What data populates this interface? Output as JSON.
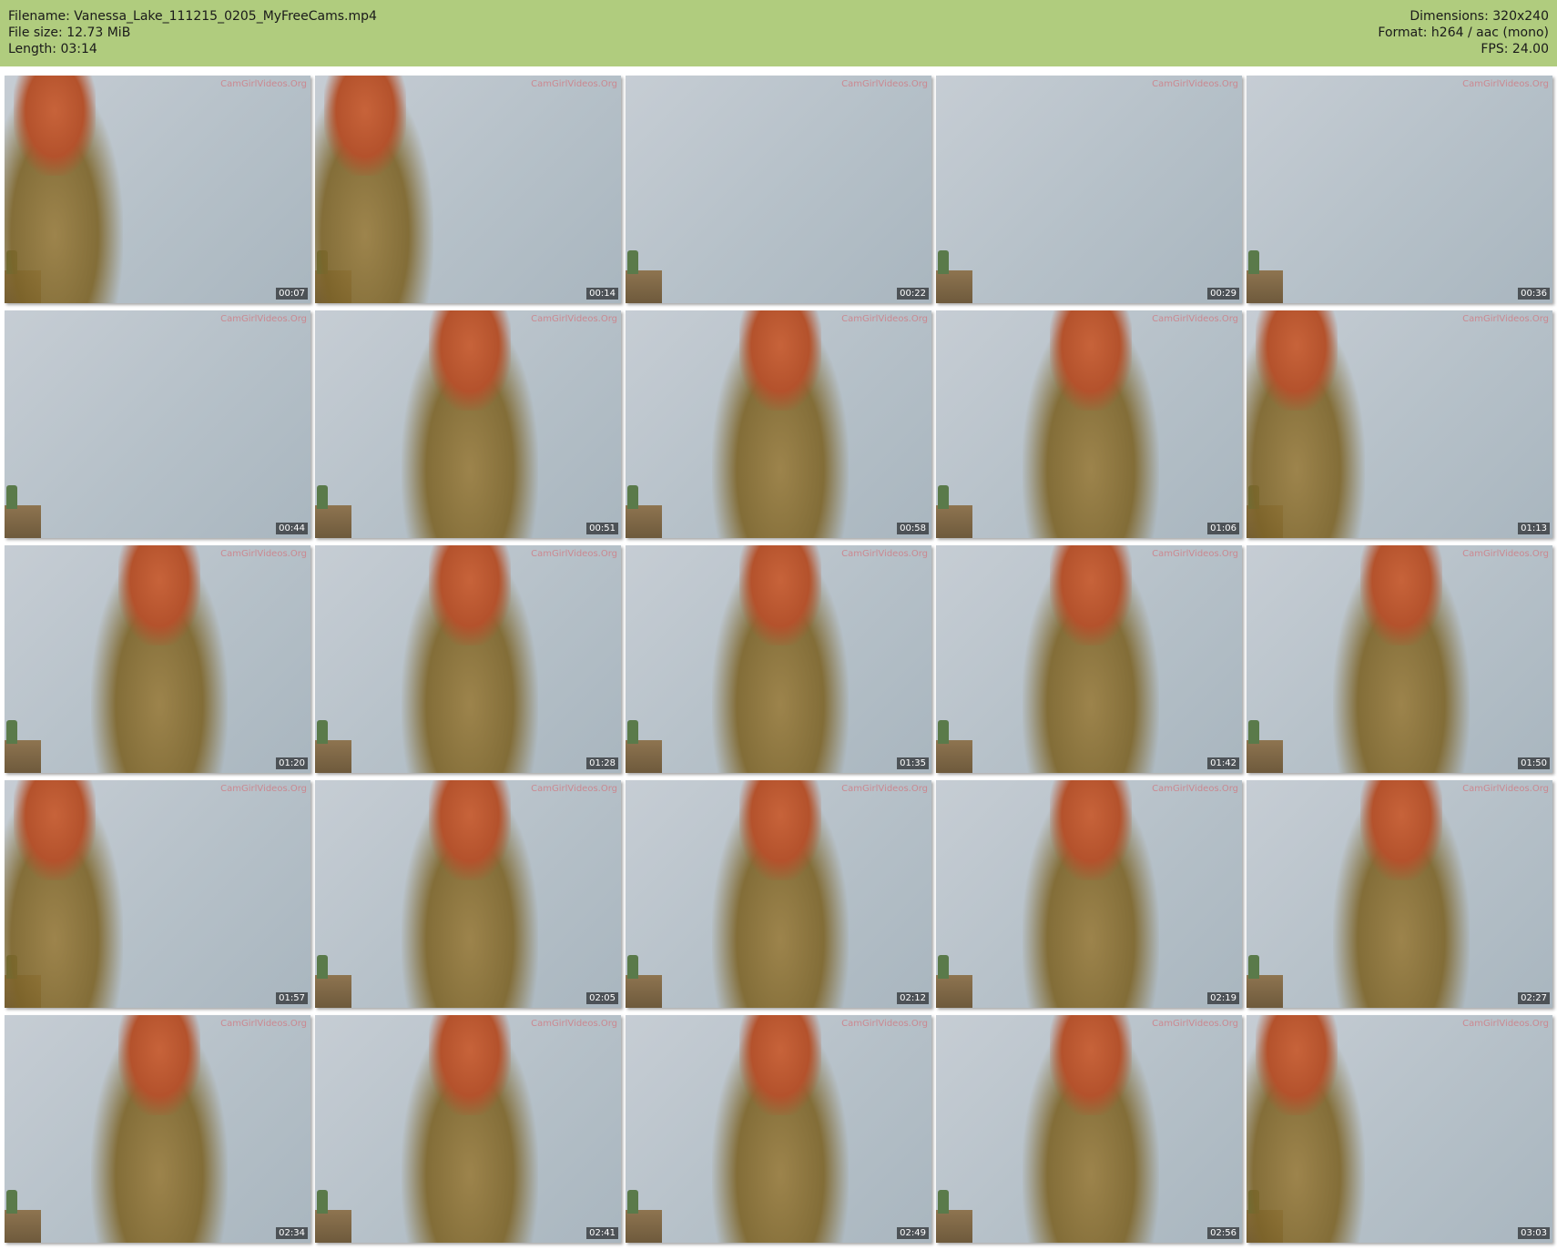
{
  "header": {
    "filename": "Filename: Vanessa_Lake_111215_0205_MyFreeCams.mp4",
    "filesize": "File size: 12.73 MiB",
    "length": "Length: 03:14",
    "dimensions": "Dimensions: 320x240",
    "format": "Format: h264 / aac (mono)",
    "fps": "FPS: 24.00"
  },
  "colors": {
    "header_bg": "#b0cc7e",
    "watermark": "#d07a82"
  },
  "watermark": "CamGirlVideos.Org",
  "thumbnails": [
    {
      "time": "00:07",
      "figure": "left"
    },
    {
      "time": "00:14",
      "figure": "left"
    },
    {
      "time": "00:22",
      "figure": "none"
    },
    {
      "time": "00:29",
      "figure": "none"
    },
    {
      "time": "00:36",
      "figure": "none"
    },
    {
      "time": "00:44",
      "figure": "none"
    },
    {
      "time": "00:51",
      "figure": "center"
    },
    {
      "time": "00:58",
      "figure": "center"
    },
    {
      "time": "01:06",
      "figure": "center"
    },
    {
      "time": "01:13",
      "figure": "left"
    },
    {
      "time": "01:20",
      "figure": "center"
    },
    {
      "time": "01:28",
      "figure": "center"
    },
    {
      "time": "01:35",
      "figure": "center"
    },
    {
      "time": "01:42",
      "figure": "center"
    },
    {
      "time": "01:50",
      "figure": "center"
    },
    {
      "time": "01:57",
      "figure": "left"
    },
    {
      "time": "02:05",
      "figure": "center"
    },
    {
      "time": "02:12",
      "figure": "center"
    },
    {
      "time": "02:19",
      "figure": "center"
    },
    {
      "time": "02:27",
      "figure": "center"
    },
    {
      "time": "02:34",
      "figure": "center"
    },
    {
      "time": "02:41",
      "figure": "center"
    },
    {
      "time": "02:49",
      "figure": "center"
    },
    {
      "time": "02:56",
      "figure": "center"
    },
    {
      "time": "03:03",
      "figure": "left"
    }
  ]
}
